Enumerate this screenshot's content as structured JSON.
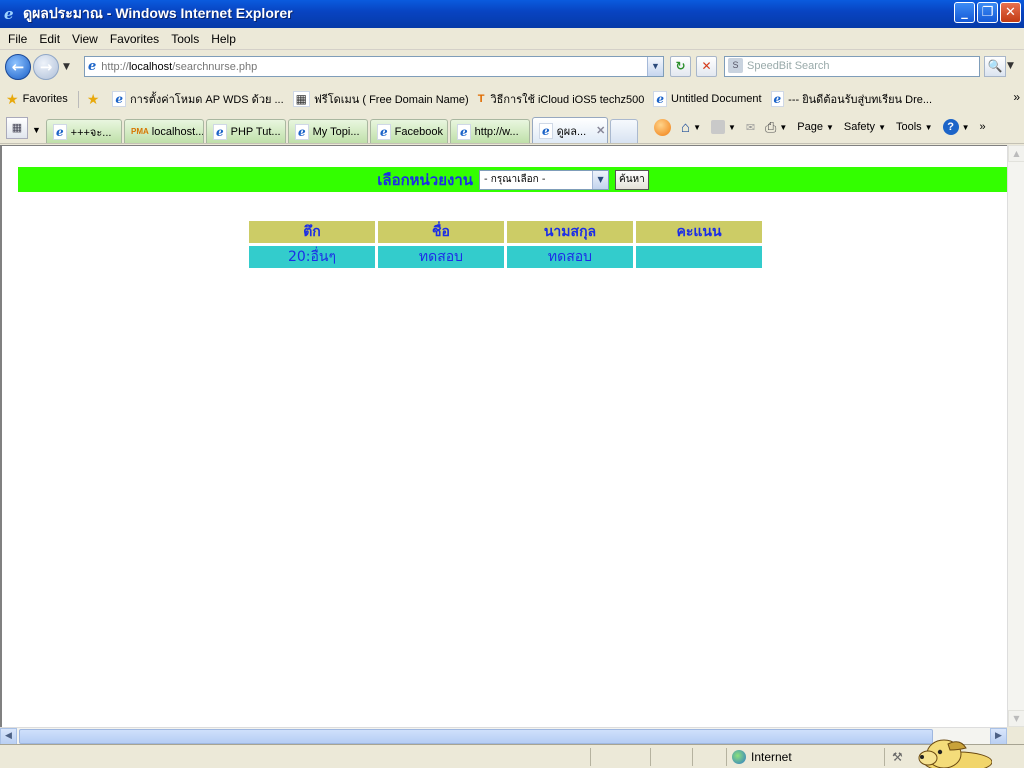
{
  "window": {
    "title": "ดูผลประมาณ - Windows Internet Explorer",
    "min_label": "_",
    "max_label": "❐",
    "close_label": "✕"
  },
  "menu": [
    "File",
    "Edit",
    "View",
    "Favorites",
    "Tools",
    "Help"
  ],
  "address": {
    "prefix": "http://",
    "host": "localhost",
    "path": "/searchnurse.php"
  },
  "search": {
    "placeholder": "SpeedBit Search"
  },
  "favorites": {
    "label": "Favorites",
    "items": [
      "การตั้งค่าโหมด AP WDS ด้วย ...",
      "ฟรีโดเมน ( Free Domain Name)",
      "วิธีการใช้ iCloud iOS5  techz500",
      "Untitled Document",
      "--- ยินดีต้อนรับสู่บทเรียน Dre..."
    ]
  },
  "tabs": [
    {
      "label": "+++จะ..."
    },
    {
      "label": "localhost..."
    },
    {
      "label": "PHP Tut..."
    },
    {
      "label": "My Topi..."
    },
    {
      "label": "Facebook"
    },
    {
      "label": "http://w..."
    },
    {
      "label": "ดูผล..."
    }
  ],
  "commands": {
    "page": "Page",
    "safety": "Safety",
    "tools": "Tools"
  },
  "page": {
    "search_label": "เลือกหน่วยงาน",
    "select_value": "- กรุณาเลือก -",
    "search_button": "ค้นหา",
    "table": {
      "headers": [
        "ตึก",
        "ชื่อ",
        "นามสกุล",
        "คะแนน"
      ],
      "rows": [
        [
          "20:อื่นๆ",
          "ทดสอบ",
          "ทดสอบ",
          ""
        ]
      ]
    }
  },
  "status": {
    "zone": "Internet"
  },
  "colors": {
    "search_bar_bg": "#33ff00",
    "header_bg": "#cccc66",
    "cell_bg": "#33cccc",
    "text_blue": "#1c2ee6"
  }
}
